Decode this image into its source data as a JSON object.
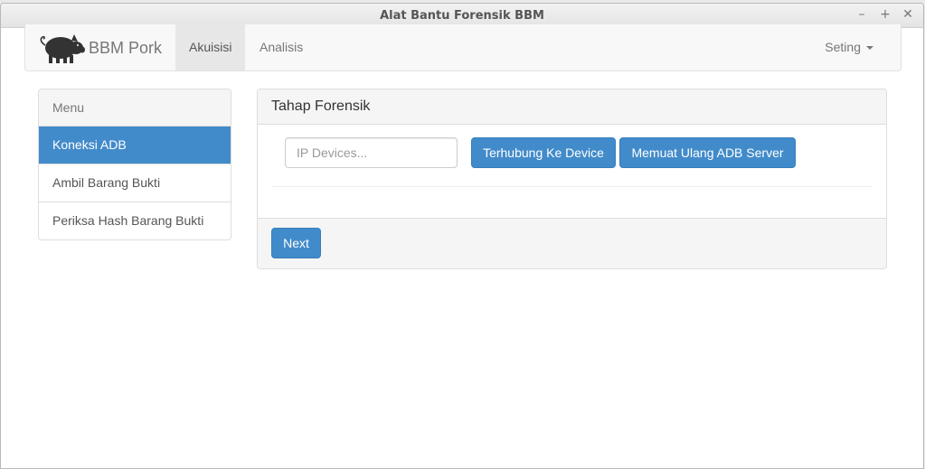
{
  "window": {
    "title": "Alat Bantu Forensik BBM",
    "controls": {
      "minimize": "–",
      "maximize": "+",
      "close": "✕"
    }
  },
  "navbar": {
    "brand": "BBM Pork",
    "brand_icon": "pig-icon",
    "tabs": [
      {
        "label": "Akuisisi",
        "active": true
      },
      {
        "label": "Analisis",
        "active": false
      }
    ],
    "settings_label": "Seting"
  },
  "sidebar": {
    "heading": "Menu",
    "items": [
      {
        "label": "Koneksi ADB",
        "active": true
      },
      {
        "label": "Ambil Barang Bukti",
        "active": false
      },
      {
        "label": "Periksa Hash Barang Bukti",
        "active": false
      }
    ]
  },
  "panel": {
    "title": "Tahap Forensik",
    "ip_input": {
      "placeholder": "IP Devices...",
      "value": ""
    },
    "connect_button": "Terhubung Ke Device",
    "reload_button": "Memuat Ulang ADB Server",
    "next_button": "Next"
  },
  "colors": {
    "primary": "#428bca",
    "navbar_bg": "#f8f8f8",
    "active_tab_bg": "#e7e7e7"
  }
}
